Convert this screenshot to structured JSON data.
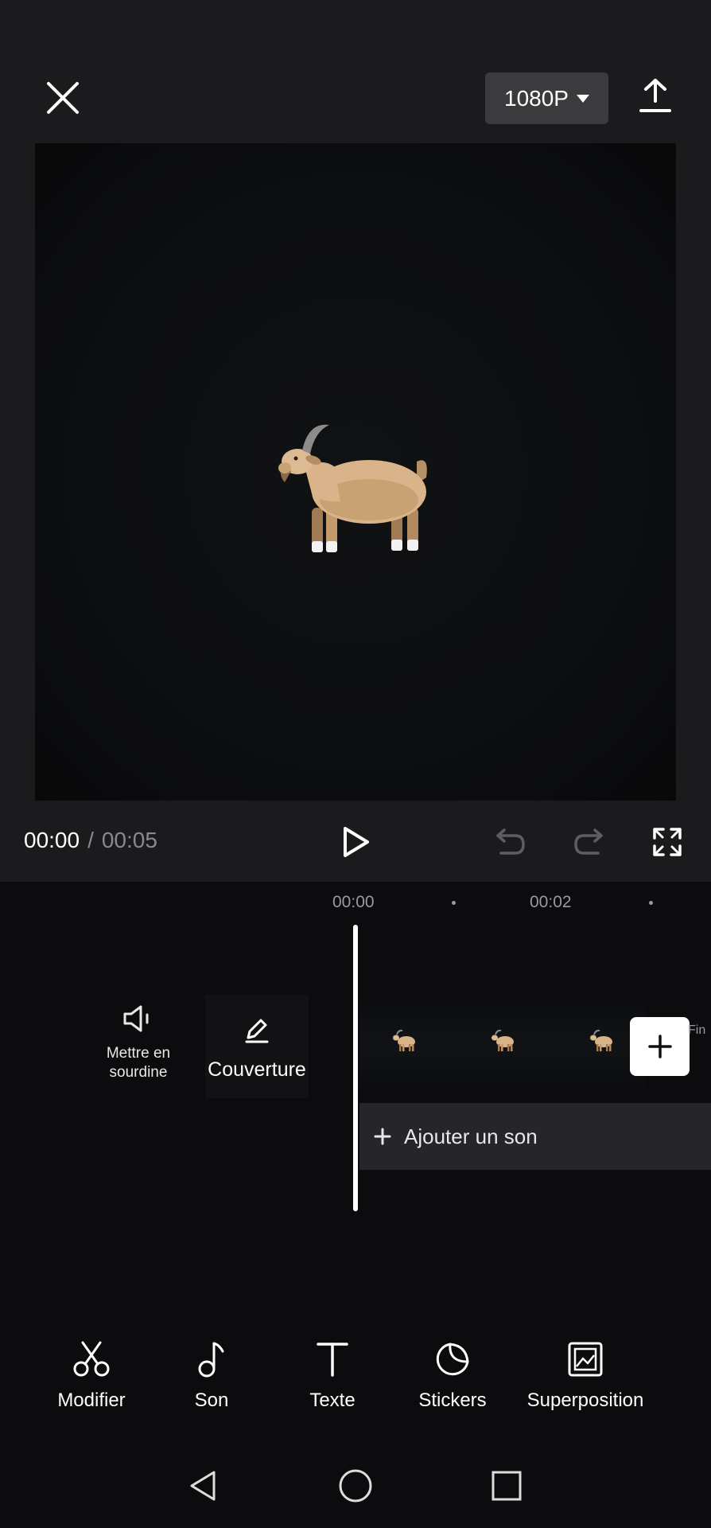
{
  "header": {
    "resolution": "1080P",
    "close_icon": "close-icon",
    "export_icon": "export-upload-icon"
  },
  "preview": {
    "content_icon": "goat-emoji"
  },
  "player": {
    "current_time": "00:00",
    "separator": "/",
    "total_time": "00:05"
  },
  "timeline": {
    "ruler": [
      "00:00",
      "00:02"
    ],
    "mute_label": "Mettre en sourdine",
    "cover_label": "Couverture",
    "end_label": "Fin",
    "add_audio_label": "Ajouter un son"
  },
  "toolbar": {
    "items": [
      {
        "label": "Modifier",
        "icon": "scissors-icon"
      },
      {
        "label": "Son",
        "icon": "music-note-icon"
      },
      {
        "label": "Texte",
        "icon": "text-icon"
      },
      {
        "label": "Stickers",
        "icon": "sticker-icon"
      },
      {
        "label": "Superposition",
        "icon": "overlay-icon"
      }
    ]
  },
  "colors": {
    "top_background": "#1b1b1d",
    "timeline_background": "#0c0c0e",
    "resolution_button": "#3b3b3e",
    "audio_track": "#26262a"
  }
}
